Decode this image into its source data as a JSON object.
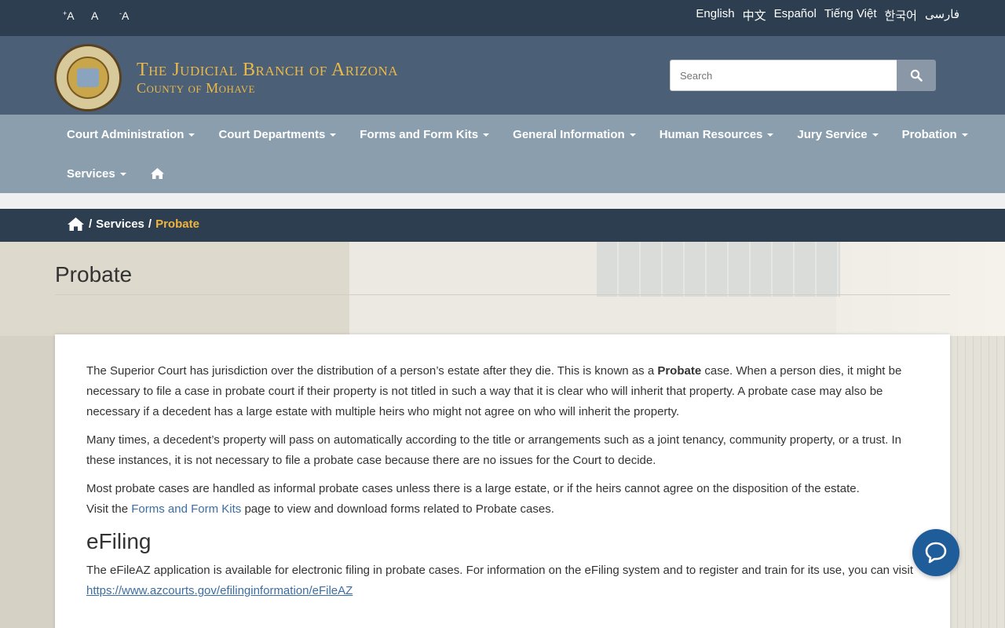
{
  "topbar": {
    "font_sizes": [
      {
        "sign": "+",
        "letter": "A"
      },
      {
        "sign": "",
        "letter": "A"
      },
      {
        "sign": "-",
        "letter": "A"
      }
    ],
    "languages": [
      "English",
      "中文",
      "Español",
      "Tiếng Việt",
      "한국어",
      "فارسی"
    ]
  },
  "header": {
    "title": "The Judicial Branch of Arizona",
    "subtitle": "County of Mohave",
    "search_placeholder": "Search",
    "seal_icon": "arizona-state-seal"
  },
  "nav": {
    "items": [
      {
        "label": "Court Administration",
        "dropdown": true
      },
      {
        "label": "Court Departments",
        "dropdown": true
      },
      {
        "label": "Forms and Form Kits",
        "dropdown": true
      },
      {
        "label": "General Information",
        "dropdown": true
      },
      {
        "label": "Human Resources",
        "dropdown": true
      },
      {
        "label": "Jury Service",
        "dropdown": true
      },
      {
        "label": "Probation",
        "dropdown": true
      },
      {
        "label": "Services",
        "dropdown": true
      }
    ]
  },
  "breadcrumb": {
    "separator": "/",
    "items": [
      "Services"
    ],
    "current": "Probate"
  },
  "page": {
    "title": "Probate",
    "p1_a": "The Superior Court has jurisdiction over the distribution of a person’s estate after they die.  This is known as a ",
    "p1_bold": "Probate",
    "p1_b": " case.  When a person dies, it might be necessary to file a case in probate court if their property is not titled in such a way that it is clear who will inherit that property.  A probate case may also be necessary if a decedent has a large estate with multiple heirs who might not agree on who will inherit the property.",
    "p2": "Many times, a decedent’s property will pass on automatically according to the title or arrangements such as a joint tenancy, community property, or a trust.  In these instances, it is not necessary to file a probate case because there are no issues for the Court to decide.",
    "p3": "Most probate cases are handled as informal probate cases unless there is a large estate, or if the heirs cannot agree on the disposition of the estate.",
    "p4_a": "Visit the ",
    "p4_link": "Forms and Form Kits",
    "p4_b": " page to view and download forms related to Probate cases.",
    "efiling_heading": "eFiling",
    "efiling_text": "The eFileAZ application is available for electronic filing in probate cases. For information on the eFiling system and to register and train for its use, you can visit",
    "efiling_link": "https://www.azcourts.gov/efilinginformation/eFileAZ"
  },
  "colors": {
    "topbar": "#2c3e50",
    "header": "#4b5f77",
    "nav": "#8a9eae",
    "brand_gold": "#e9b94a",
    "breadcrumb_current": "#f0b53f",
    "link": "#3a6ea5",
    "chat": "#1f5c9a"
  }
}
